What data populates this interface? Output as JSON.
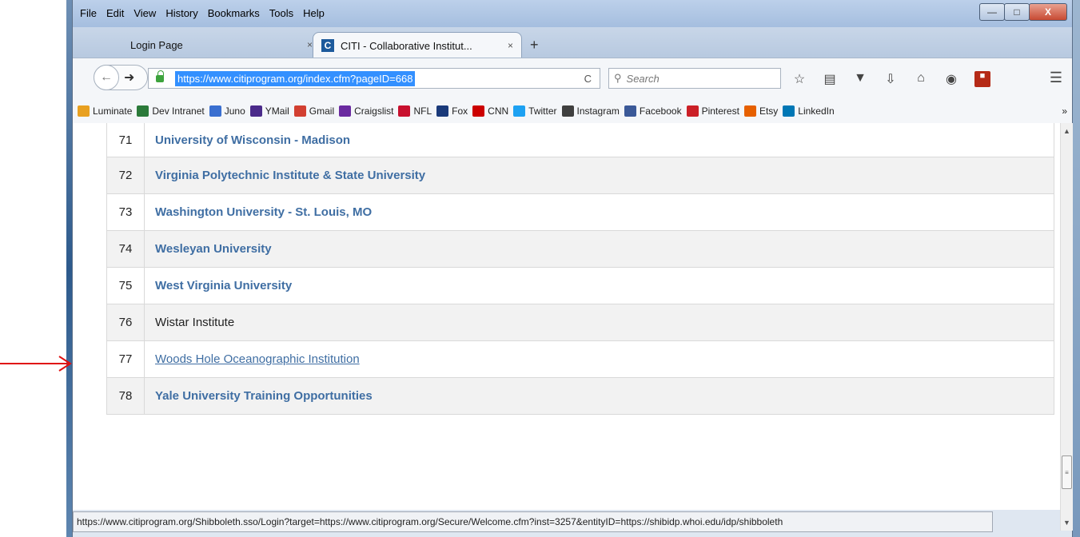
{
  "menu": [
    "File",
    "Edit",
    "View",
    "History",
    "Bookmarks",
    "Tools",
    "Help"
  ],
  "window_controls": {
    "minimize": "—",
    "maximize": "□",
    "close": "X"
  },
  "tabs": [
    {
      "label": "Login Page",
      "close": "×"
    },
    {
      "label": "CITI - Collaborative Institut...",
      "close": "×",
      "favicon": "C"
    }
  ],
  "new_tab": "+",
  "nav": {
    "url": "https://www.citiprogram.org/index.cfm?pageID=668",
    "search_placeholder": "Search",
    "reload": "C"
  },
  "bookmarks": [
    {
      "label": "Luminate",
      "icon": "luminate-icon",
      "color": "#e8a020"
    },
    {
      "label": "Dev Intranet",
      "icon": "dev-intranet-icon",
      "color": "#2b7a3a"
    },
    {
      "label": "Juno",
      "icon": "juno-icon",
      "color": "#3a6fd0"
    },
    {
      "label": "YMail",
      "icon": "ymail-icon",
      "color": "#4a2a8a"
    },
    {
      "label": "Gmail",
      "icon": "gmail-icon",
      "color": "#d23f31"
    },
    {
      "label": "Craigslist",
      "icon": "craigslist-icon",
      "color": "#6a2aa0"
    },
    {
      "label": "NFL",
      "icon": "nfl-icon",
      "color": "#c8102e"
    },
    {
      "label": "Fox",
      "icon": "fox-icon",
      "color": "#1a3a7a"
    },
    {
      "label": "CNN",
      "icon": "cnn-icon",
      "color": "#cc0000"
    },
    {
      "label": "Twitter",
      "icon": "twitter-icon",
      "color": "#1da1f2"
    },
    {
      "label": "Instagram",
      "icon": "instagram-icon",
      "color": "#3f3f3f"
    },
    {
      "label": "Facebook",
      "icon": "facebook-icon",
      "color": "#3b5998"
    },
    {
      "label": "Pinterest",
      "icon": "pinterest-icon",
      "color": "#cb2027"
    },
    {
      "label": "Etsy",
      "icon": "etsy-icon",
      "color": "#e66000"
    },
    {
      "label": "LinkedIn",
      "icon": "linkedin-icon",
      "color": "#0077b5"
    }
  ],
  "bookmarks_more": "»",
  "institutions": [
    {
      "num": "71",
      "name": "University of Wisconsin - Madison",
      "style": "link"
    },
    {
      "num": "72",
      "name": "Virginia Polytechnic Institute & State University",
      "style": "link"
    },
    {
      "num": "73",
      "name": "Washington University - St. Louis, MO",
      "style": "link"
    },
    {
      "num": "74",
      "name": "Wesleyan University",
      "style": "link"
    },
    {
      "num": "75",
      "name": "West Virginia University",
      "style": "link"
    },
    {
      "num": "76",
      "name": "Wistar Institute",
      "style": "plain"
    },
    {
      "num": "77",
      "name": "Woods Hole Oceanographic Institution",
      "style": "hover"
    },
    {
      "num": "78",
      "name": "Yale University Training Opportunities",
      "style": "link"
    }
  ],
  "status_url": "https://www.citiprogram.org/Shibboleth.sso/Login?target=https://www.citiprogram.org/Secure/Welcome.cfm?inst=3257&entityID=https://shibidp.whoi.edu/idp/shibboleth",
  "colors": {
    "link": "#3f6ea3",
    "arrow": "#e01010",
    "url_highlight": "#3390ff"
  }
}
